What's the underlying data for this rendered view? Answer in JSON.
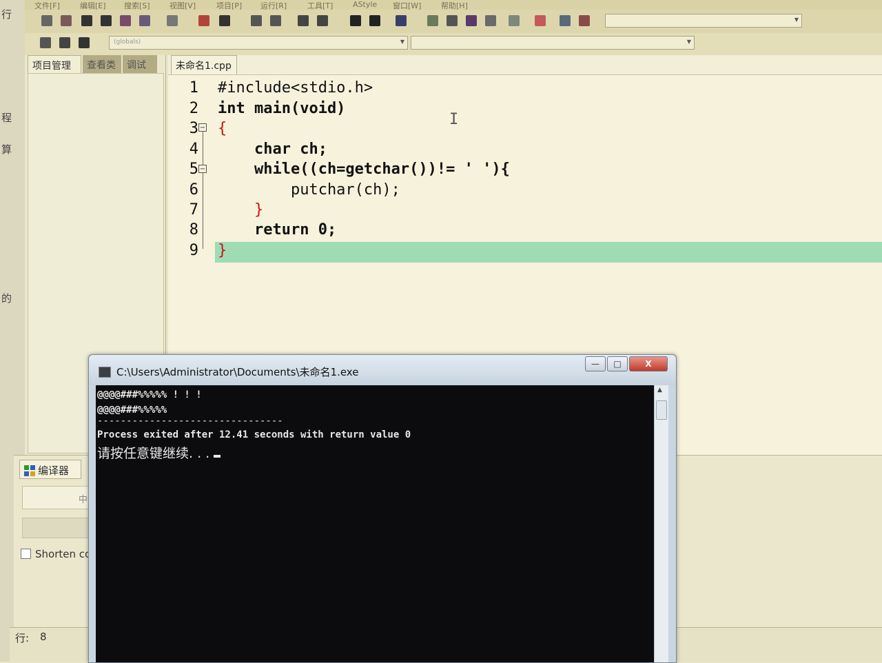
{
  "menu": {
    "items": [
      "文件[F]",
      "编辑[E]",
      "搜索[S]",
      "视图[V]",
      "项目[P]",
      "运行[R]",
      "工具[T]",
      "AStyle",
      "窗口[W]",
      "帮助[H]"
    ]
  },
  "left_edge": {
    "words": [
      "行",
      "程",
      "算",
      "的"
    ]
  },
  "toolbar2": {
    "compiler_select": "(globals)"
  },
  "left_panel": {
    "tabs": [
      "项目管理",
      "查看类",
      "调试"
    ]
  },
  "editor": {
    "tab_label": "未命名1.cpp",
    "lines": [
      {
        "num": "1",
        "code": "#include<stdio.h>"
      },
      {
        "num": "2",
        "code": "int main(void)"
      },
      {
        "num": "3",
        "code": "{"
      },
      {
        "num": "4",
        "code": "    char ch;"
      },
      {
        "num": "5",
        "code": "    while((ch=getchar())!= ' '){"
      },
      {
        "num": "6",
        "code": "        putchar(ch);"
      },
      {
        "num": "7",
        "code": "    }"
      },
      {
        "num": "8",
        "code": "    return 0;"
      },
      {
        "num": "9",
        "code": "}"
      }
    ]
  },
  "bottom_panel": {
    "compiler_tab": "编译器",
    "field1": "中",
    "shorten_label": "Shorten co"
  },
  "statusbar": {
    "line_label": "行:",
    "line_value": "8"
  },
  "console": {
    "title": "C:\\Users\\Administrator\\Documents\\未命名1.exe",
    "minimize": "—",
    "maximize": "□",
    "close": "X",
    "lines": [
      "@@@@###%%%%% ! ! !",
      "@@@@###%%%%%",
      "--------------------------------",
      "Process exited after 12.41 seconds with return value 0",
      "请按任意键继续. . ."
    ]
  }
}
